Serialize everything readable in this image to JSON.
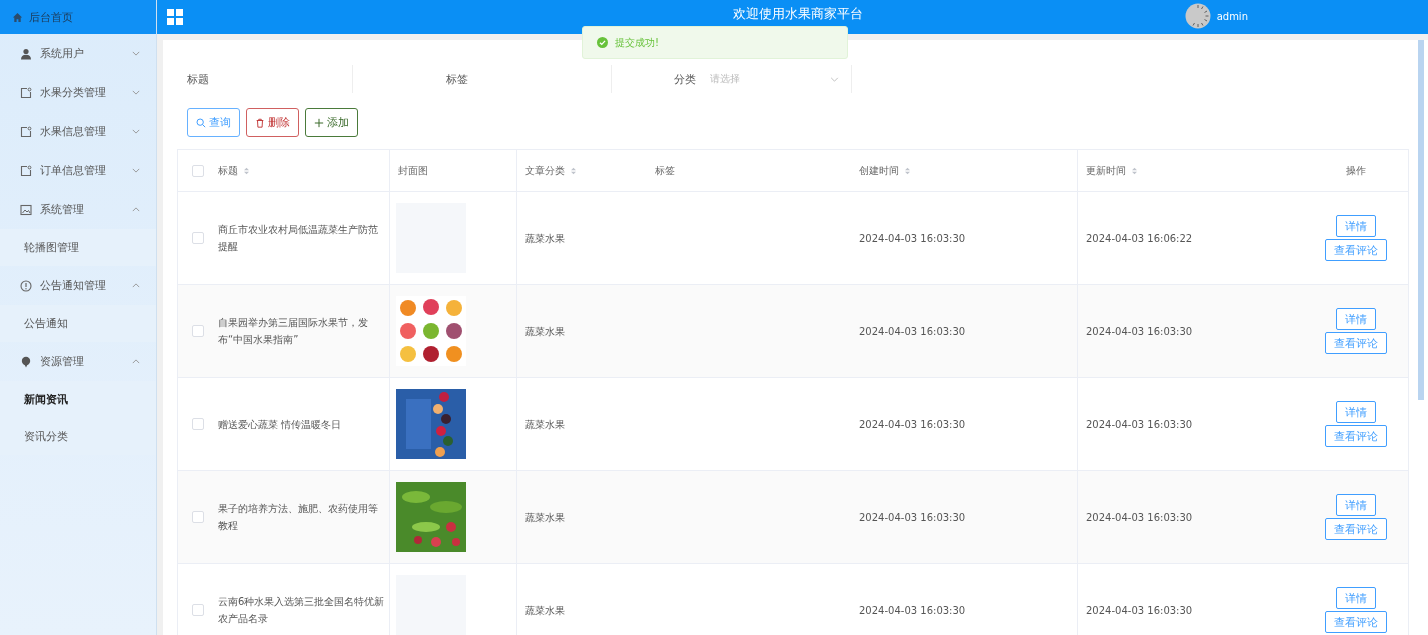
{
  "sidebar": {
    "home": "后台首页",
    "items": [
      {
        "label": "系统用户",
        "expanded": false
      },
      {
        "label": "水果分类管理",
        "expanded": false
      },
      {
        "label": "水果信息管理",
        "expanded": false
      },
      {
        "label": "订单信息管理",
        "expanded": false
      },
      {
        "label": "系统管理",
        "expanded": true,
        "children": [
          {
            "label": "轮播图管理",
            "selected": false
          }
        ]
      },
      {
        "label": "公告通知管理",
        "expanded": true,
        "children": [
          {
            "label": "公告通知",
            "selected": false
          }
        ]
      },
      {
        "label": "资源管理",
        "expanded": true,
        "children": [
          {
            "label": "新闻资讯",
            "selected": true
          },
          {
            "label": "资讯分类",
            "selected": false
          }
        ]
      }
    ]
  },
  "header": {
    "title": "欢迎使用水果商家平台",
    "user": "admin"
  },
  "toast": {
    "message": "提交成功!"
  },
  "filters": [
    {
      "kind": "input",
      "label": "标题"
    },
    {
      "kind": "input",
      "label": "标签"
    },
    {
      "kind": "select",
      "label": "分类",
      "placeholder": "请选择"
    }
  ],
  "actions": [
    {
      "kind": "primary",
      "label": "查询"
    },
    {
      "kind": "danger",
      "label": "删除"
    },
    {
      "kind": "success",
      "label": "添加"
    }
  ],
  "table": {
    "all_checked": false,
    "columns": [
      {
        "label": "标题",
        "sortable": true
      },
      {
        "label": "封面图",
        "sortable": false
      },
      {
        "label": "文章分类",
        "sortable": true
      },
      {
        "label": "标签",
        "sortable": false
      },
      {
        "label": "创建时间",
        "sortable": true
      },
      {
        "label": "更新时间",
        "sortable": true
      },
      {
        "label": "操作",
        "sortable": false
      }
    ],
    "rows": [
      {
        "checked": false,
        "title": "商丘市农业农村局低温蔬菜生产防范提醒",
        "cover": {
          "kind": "empty"
        },
        "category": "蔬菜水果",
        "created": "2024-04-03 16:03:30",
        "updated": "2024-04-03 16:06:22",
        "buttons": [
          "详情",
          "查看评论"
        ]
      },
      {
        "checked": false,
        "title": "自果园举办第三届国际水果节，发布“中国水果指南”",
        "cover": {
          "kind": "picture"
        },
        "category": "蔬菜水果",
        "created": "2024-04-03 16:03:30",
        "updated": "2024-04-03 16:03:30",
        "buttons": [
          "详情",
          "查看评论"
        ]
      },
      {
        "checked": false,
        "title": "赠送爱心蔬菜 情传温暖冬日",
        "cover": {
          "kind": "picture"
        },
        "category": "蔬菜水果",
        "created": "2024-04-03 16:03:30",
        "updated": "2024-04-03 16:03:30",
        "buttons": [
          "详情",
          "查看评论"
        ]
      },
      {
        "checked": false,
        "title": "果子的培养方法、施肥、农药使用等教程",
        "cover": {
          "kind": "picture"
        },
        "category": "蔬菜水果",
        "created": "2024-04-03 16:03:30",
        "updated": "2024-04-03 16:03:30",
        "buttons": [
          "详情",
          "查看评论"
        ]
      },
      {
        "checked": false,
        "title": "云南6种水果入选第三批全国名特优新农产品名录",
        "cover": {
          "kind": "empty"
        },
        "category": "蔬菜水果",
        "created": "2024-04-03 16:03:30",
        "updated": "2024-04-03 16:03:30",
        "buttons": [
          "详情",
          "查看评论"
        ]
      }
    ]
  }
}
